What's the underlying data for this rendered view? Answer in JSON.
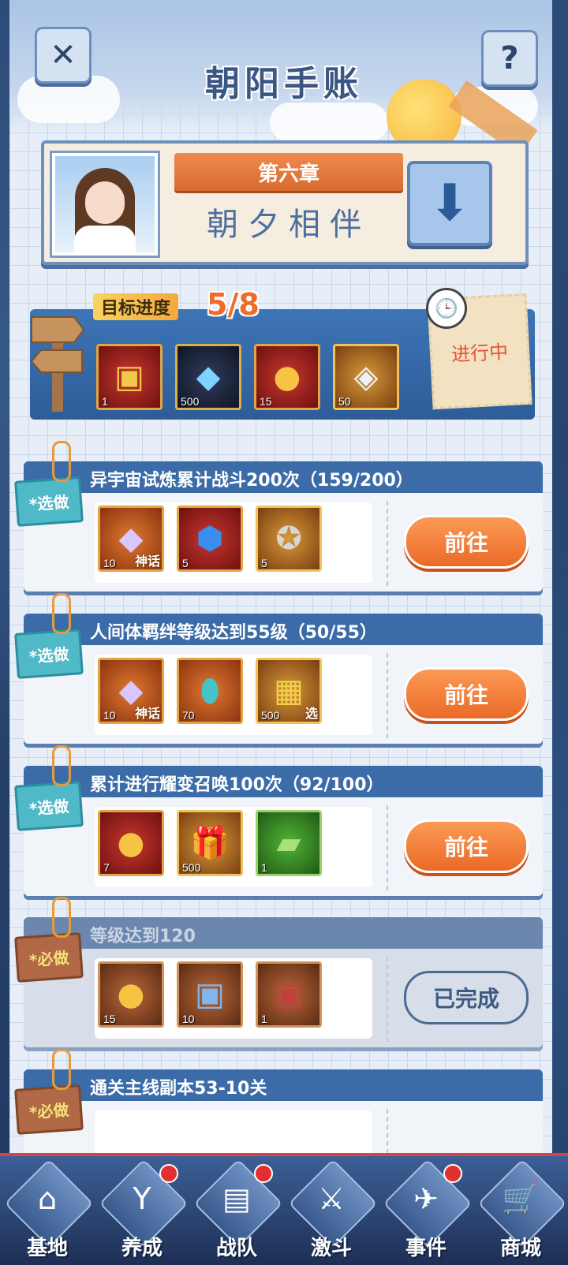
{
  "header": {
    "title": "朝阳手账",
    "close_icon": "close-icon",
    "help_icon": "help-icon"
  },
  "chapter": {
    "number": "第六章",
    "name": "朝夕相伴",
    "toggle_icon": "arrow-down-icon"
  },
  "goal": {
    "label": "目标进度",
    "progress": "5/8",
    "status": "进行中",
    "rewards": [
      {
        "icon": "treasure-chest-icon",
        "count": "1",
        "rarity": "red"
      },
      {
        "icon": "blue-crystal-icon",
        "count": "500",
        "rarity": "blue"
      },
      {
        "icon": "gold-medal-icon",
        "count": "15",
        "rarity": "red"
      },
      {
        "icon": "prism-crystal-icon",
        "count": "50",
        "rarity": "gold"
      }
    ]
  },
  "tasks": [
    {
      "tag": "*选做",
      "type": "optional",
      "title": "异宇宙试炼累计战斗200次（159/200）",
      "button": "前往",
      "completed": false,
      "rewards": [
        {
          "icon": "myth-crystal-icon",
          "count": "10",
          "label": "神话",
          "rarity": "orange"
        },
        {
          "icon": "blue-gem-icon",
          "count": "5",
          "label": "",
          "rarity": "red"
        },
        {
          "icon": "emblem-badge-icon",
          "count": "5",
          "label": "",
          "rarity": "gold"
        }
      ]
    },
    {
      "tag": "*选做",
      "type": "optional",
      "title": "人间体羁绊等级达到55级（50/55）",
      "button": "前往",
      "completed": false,
      "rewards": [
        {
          "icon": "myth-crystal-icon",
          "count": "10",
          "label": "神话",
          "rarity": "orange"
        },
        {
          "icon": "capsule-icon",
          "count": "70",
          "label": "",
          "rarity": "orange"
        },
        {
          "icon": "select-box-icon",
          "count": "500",
          "label": "选",
          "rarity": "gold"
        }
      ]
    },
    {
      "tag": "*选做",
      "type": "optional",
      "title": "累计进行耀变召唤100次（92/100）",
      "button": "前往",
      "completed": false,
      "rewards": [
        {
          "icon": "legend-medal-icon",
          "count": "7",
          "label": "",
          "rarity": "red"
        },
        {
          "icon": "gift-box-icon",
          "count": "500",
          "label": "",
          "rarity": "gold"
        },
        {
          "icon": "green-bag-icon",
          "count": "1",
          "label": "",
          "rarity": "green"
        }
      ]
    },
    {
      "tag": "*必做",
      "type": "required",
      "title": "等级达到120",
      "button": "已完成",
      "completed": true,
      "rewards": [
        {
          "icon": "legend-medal-icon",
          "count": "15",
          "label": "",
          "rarity": "copper"
        },
        {
          "icon": "blue-chest-icon",
          "count": "10",
          "label": "",
          "rarity": "copper"
        },
        {
          "icon": "red-chest-icon",
          "count": "1",
          "label": "",
          "rarity": "copper"
        }
      ]
    },
    {
      "tag": "*必做",
      "type": "required",
      "title": "通关主线副本53-10关",
      "button": "",
      "completed": false,
      "rewards": []
    }
  ],
  "nav": [
    {
      "label": "基地",
      "icon": "base-icon",
      "glyph": "⌂",
      "dot": false
    },
    {
      "label": "养成",
      "icon": "upgrade-icon",
      "glyph": "Y",
      "dot": true
    },
    {
      "label": "战队",
      "icon": "team-cards-icon",
      "glyph": "▤",
      "dot": true
    },
    {
      "label": "激斗",
      "icon": "battle-icon",
      "glyph": "⚔",
      "dot": false
    },
    {
      "label": "事件",
      "icon": "event-jet-icon",
      "glyph": "✈",
      "dot": true
    },
    {
      "label": "商城",
      "icon": "shop-cart-icon",
      "glyph": "🛒",
      "dot": false
    }
  ],
  "colors": {
    "accent_orange": "#ea6a27",
    "panel_blue": "#3c6ca8",
    "progress_orange": "#f06a2a"
  }
}
